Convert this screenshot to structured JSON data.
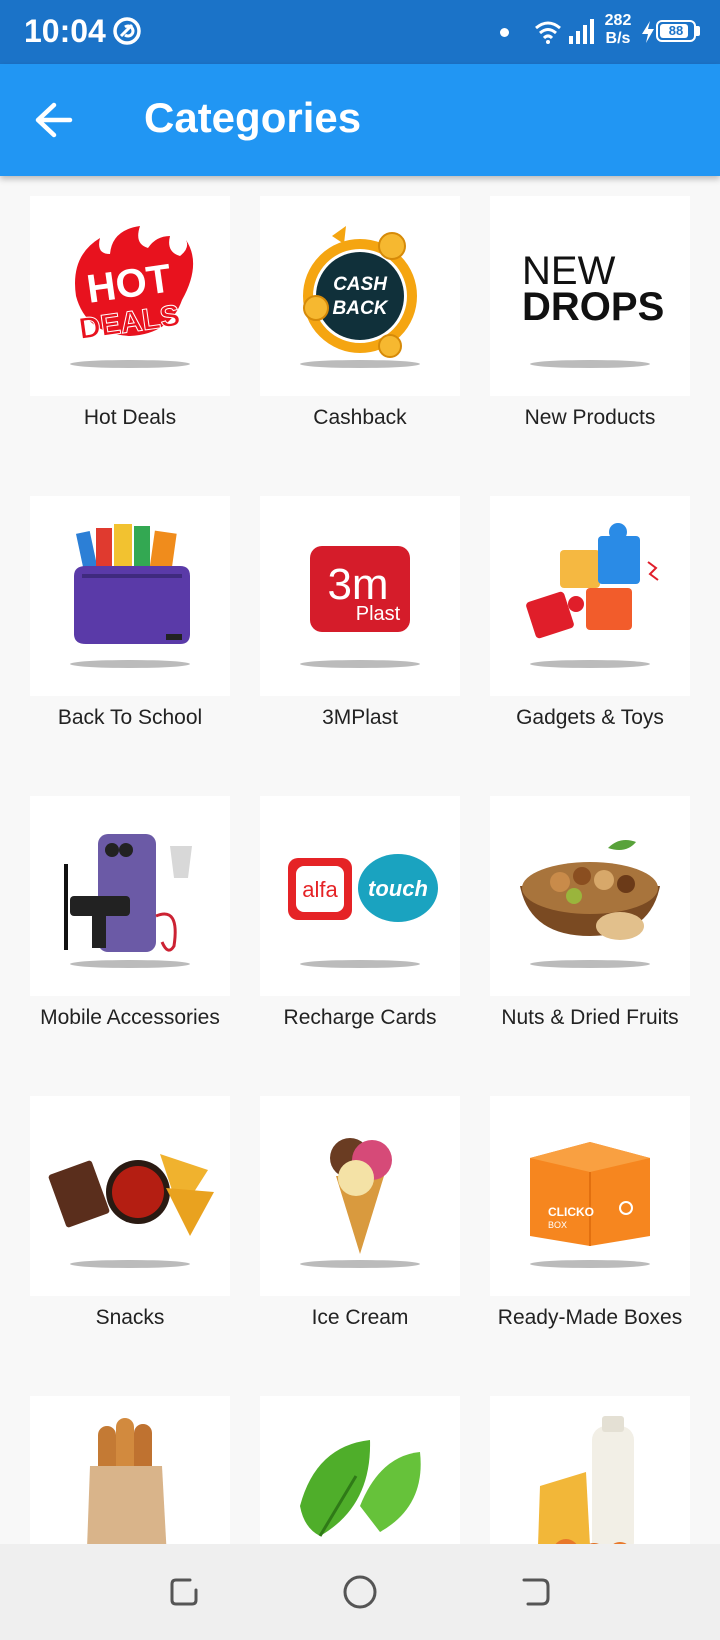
{
  "status_bar": {
    "time": "10:04",
    "speed": "282 B/s",
    "battery": "88",
    "battery_level": 0.88
  },
  "app_bar": {
    "title": "Categories",
    "back_icon": "arrow-left-icon"
  },
  "categories": [
    {
      "label": "Hot Deals",
      "image": "hot-deals-logo"
    },
    {
      "label": "Cashback",
      "image": "cashback-logo"
    },
    {
      "label": "New Products",
      "image": "new-drops-logo"
    },
    {
      "label": "Back To School",
      "image": "school-bag-image"
    },
    {
      "label": "3MPlast",
      "image": "3mplast-logo"
    },
    {
      "label": "Gadgets & Toys",
      "image": "puzzle-image"
    },
    {
      "label": "Mobile Accessories",
      "image": "phone-accessories-image"
    },
    {
      "label": "Recharge Cards",
      "image": "alfa-touch-logo"
    },
    {
      "label": "Nuts & Dried Fruits",
      "image": "nuts-image"
    },
    {
      "label": "Snacks",
      "image": "snacks-image"
    },
    {
      "label": "Ice Cream",
      "image": "ice-cream-image"
    },
    {
      "label": "Ready-Made Boxes",
      "image": "clicko-box-image"
    },
    {
      "label": "",
      "image": "bread-image"
    },
    {
      "label": "",
      "image": "leaf-image"
    },
    {
      "label": "",
      "image": "dairy-image"
    }
  ],
  "nav_bar": {
    "recent_icon": "recent-apps-icon",
    "home_icon": "home-circle-icon",
    "back_icon": "nav-back-icon"
  },
  "images_text": {
    "hot": "HOT",
    "deals": "DEALS",
    "cash": "CASH",
    "back": "BACK",
    "new": "NEW",
    "drops": "DROPS",
    "three_m": "3m",
    "plast": "Plast",
    "alfa": "alfa",
    "touch": "touch",
    "clicko": "CLICKO",
    "box": "BOX"
  }
}
